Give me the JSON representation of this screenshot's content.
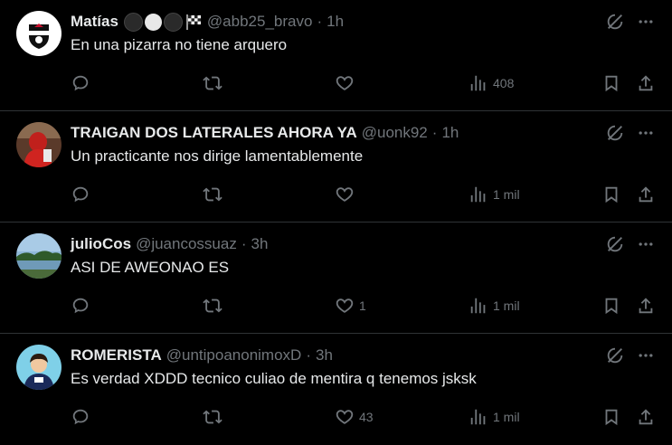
{
  "colors": {
    "background": "#000000",
    "text_primary": "#e7e9ea",
    "text_secondary": "#71767b",
    "divider": "#2f3336"
  },
  "tweets": [
    {
      "display_name": "Matías",
      "handle": "@abb25_bravo",
      "separator": "·",
      "time": "1h",
      "emojis": [
        "black-circle",
        "white-circle",
        "black-circle",
        "checkered-flag"
      ],
      "text": "En una pizarra no tiene arquero",
      "replies": "",
      "retweets": "",
      "likes": "",
      "views": "408",
      "avatar": "colo-colo-crest"
    },
    {
      "display_name": "TRAIGAN DOS LATERALES AHORA YA",
      "handle": "@uonk92",
      "separator": "·",
      "time": "1h",
      "emojis": [],
      "text": "Un practicante nos dirige lamentablemente",
      "replies": "",
      "retweets": "",
      "likes": "",
      "views": "1 mil",
      "avatar": "red-figure-photo"
    },
    {
      "display_name": "julioCos",
      "handle": "@juancossuaz",
      "separator": "·",
      "time": "3h",
      "emojis": [],
      "text": "ASI DE AWEONAO ES",
      "replies": "",
      "retweets": "",
      "likes": "1",
      "views": "1 mil",
      "avatar": "lake-landscape-photo"
    },
    {
      "display_name": "ROMERISTA",
      "handle": "@untipoanonimoxD",
      "separator": "·",
      "time": "3h",
      "emojis": [],
      "text": "Es verdad XDDD tecnico culiao de mentira q tenemos jsksk",
      "replies": "",
      "retweets": "",
      "likes": "43",
      "views": "1 mil",
      "avatar": "anime-player-drawing"
    }
  ]
}
